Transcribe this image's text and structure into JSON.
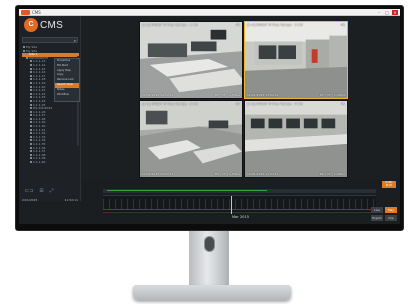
{
  "app": {
    "title_bar_text": "CMS",
    "logo_mark": "C",
    "logo_text": "CMS"
  },
  "window_controls": [
    "–",
    "□",
    "×"
  ],
  "sidebar": {
    "tree": [
      {
        "label": "My Site"
      },
      {
        "label": "My Site"
      },
      {
        "label": "Site 1",
        "selected": true
      },
      {
        "label": "HIKVISION IP"
      },
      {
        "label": "1.1.1.13"
      },
      {
        "label": "1.1.1.14"
      },
      {
        "label": "1.1.1.15"
      },
      {
        "label": "1.1.1.16"
      },
      {
        "label": "1.1.1.17"
      },
      {
        "label": "1.1.1.18"
      },
      {
        "label": "1.1.1.19"
      },
      {
        "label": "1.1.1.20"
      },
      {
        "label": "1.1.1.21"
      },
      {
        "label": "1.1.1.22"
      },
      {
        "label": "1.1.1.23"
      },
      {
        "label": "1.1.1.24"
      },
      {
        "label": "1.1.1.25"
      },
      {
        "label": "DS-2CD2032"
      },
      {
        "label": "1.1.1.26"
      },
      {
        "label": "1.1.1.27"
      },
      {
        "label": "1.1.1.28"
      },
      {
        "label": "1.1.1.29"
      },
      {
        "label": "1.1.1.30"
      },
      {
        "label": "1.1.1.31"
      },
      {
        "label": "1.1.1.32"
      },
      {
        "label": "1.1.1.33"
      },
      {
        "label": "1.1.1.34"
      },
      {
        "label": "1.1.1.35"
      },
      {
        "label": "1.1.1.36"
      },
      {
        "label": "1.1.1.37"
      },
      {
        "label": "1.1.1.38"
      },
      {
        "label": "1.1.1.39"
      },
      {
        "label": "1.1.1.40"
      }
    ],
    "context_menu": [
      {
        "label": "Properties"
      },
      {
        "label": "Ptz Start"
      },
      {
        "label": "Apply Map"
      },
      {
        "label": "Copy"
      },
      {
        "label": "Remove Link"
      },
      {
        "label": "Search View",
        "active": true
      },
      {
        "label": "Notes"
      },
      {
        "label": "Workflow"
      }
    ],
    "footer": {
      "date": "2/01/2015",
      "time": "11:52:11"
    }
  },
  "cameras": [
    {
      "label": "[1-3] PANSY IP Plus Tampa · 1 CH",
      "res": "4K",
      "timestamp": "12/01/2015 11:52:11",
      "info": "DH | CF | 1-Mbps",
      "selected": false
    },
    {
      "label": "[1-4] PANSY IP Plus Tampa · 2 CH",
      "res": "4K",
      "timestamp": "12/01/2015 11:52:11",
      "info": "DH | CF | 1-Mbps",
      "selected": true
    },
    {
      "label": "[1-5] PANSY IP Plus Tampa · 3 CH",
      "res": "4K",
      "timestamp": "12/01/2015 11:52:11",
      "info": "DH | CF | 1-Mbps",
      "selected": false
    },
    {
      "label": "[1-6] PANSY IP Plus Tampa · 4 CH",
      "res": "4K",
      "timestamp": "12/01/2015 11:52:11",
      "info": "DH | CF | 1-Mbps",
      "selected": false
    }
  ],
  "timeline": {
    "date_label": "Mar 2015",
    "badge": "SYNC PLAY",
    "buttons": [
      {
        "label": "Live",
        "accent": false
      },
      {
        "label": "Play",
        "accent": true
      },
      {
        "label": "Export",
        "accent": false
      },
      {
        "label": "Clip",
        "accent": false
      }
    ]
  }
}
